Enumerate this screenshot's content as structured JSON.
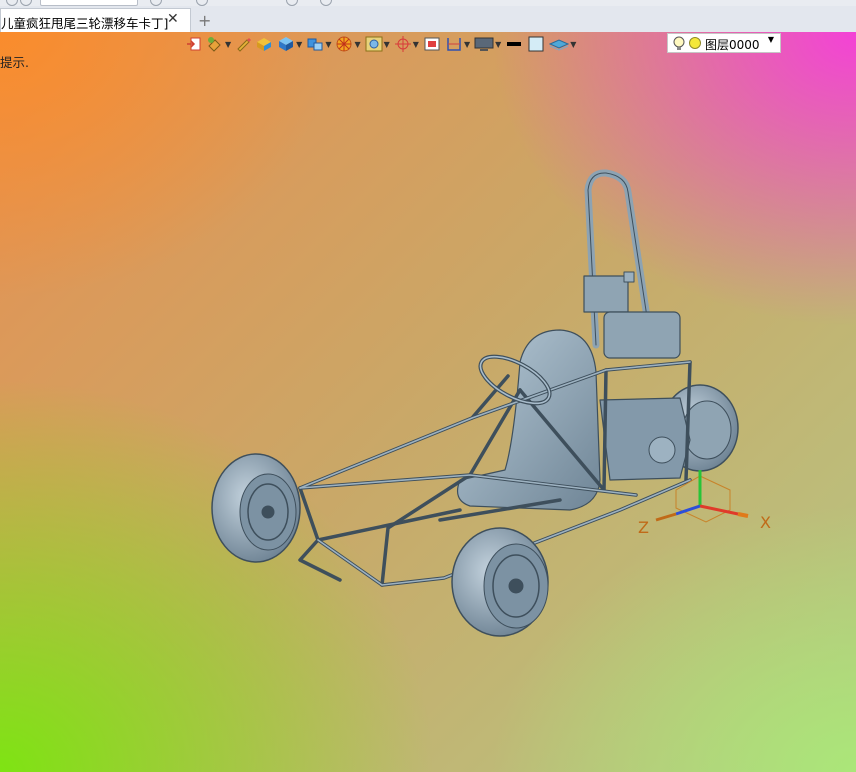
{
  "tab": {
    "title": "儿童疯狂甩尾三轮漂移车卡丁]",
    "close_glyph": "✕"
  },
  "new_tab_glyph": "+",
  "status_hint": "提示.",
  "toolbar": {
    "icons": [
      "import-icon",
      "paint-bucket-icon",
      "pencil-icon",
      "shaded-box-icon",
      "cube-icon",
      "extrude-icon",
      "color-wheel-icon",
      "view-frame-icon",
      "crosshair-icon",
      "zoom-fit-icon",
      "section-icon",
      "display-mode-icon",
      "line-color-icon",
      "fill-color-icon",
      "layer-style-icon"
    ],
    "layer": {
      "name": "图层0000"
    }
  },
  "axes": {
    "x_label": "X",
    "z_label": "Z"
  },
  "colors": {
    "axis_x": "#e03a2a",
    "axis_z": "#2d4fd8",
    "axis_y": "#27c438",
    "axis_label": "#c06a18",
    "model": "#8da3b3"
  }
}
